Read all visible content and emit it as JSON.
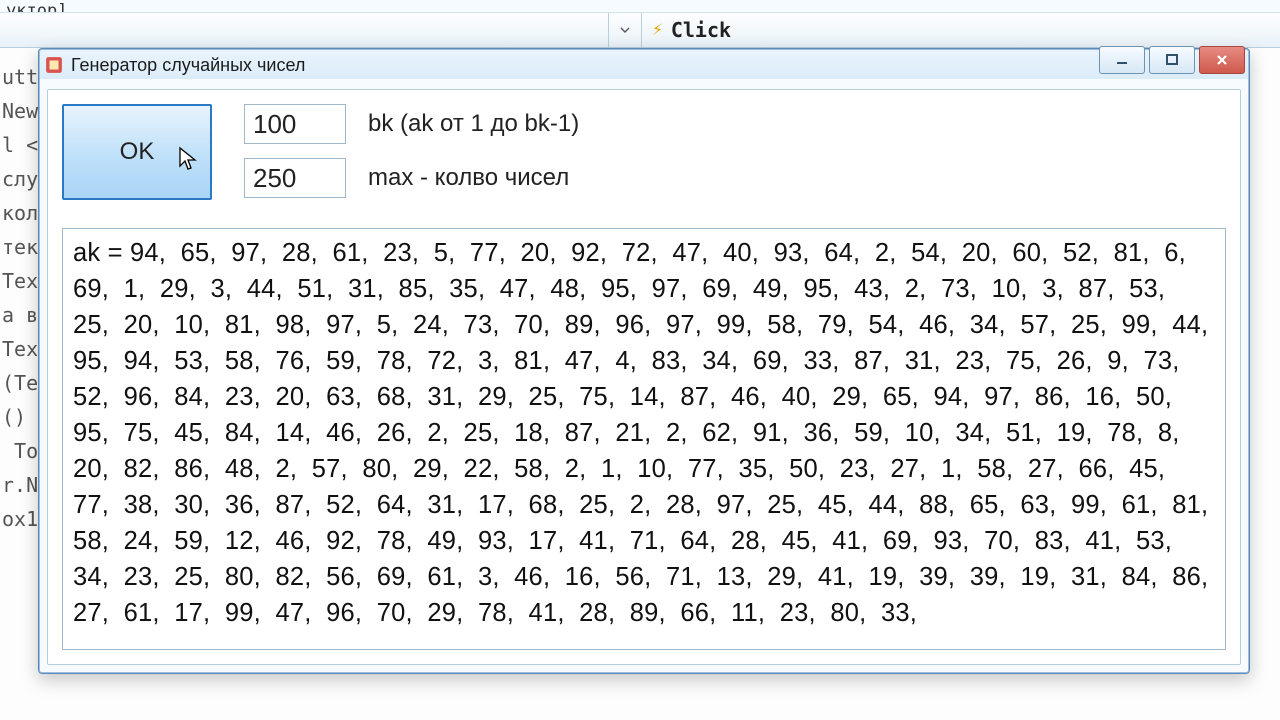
{
  "ide": {
    "title_fragment": "уктор]",
    "toolbar_item": "Click",
    "code_lines": [
      "utt",
      "New",
      "l <",
      "слу",
      "кол",
      "",
      "тек",
      "Tex",
      "а в",
      "Tex",
      "(Te",
      "",
      "()",
      " To",
      "",
      "r.N",
      "",
      "ox1"
    ]
  },
  "window": {
    "title": "Генератор случайных чисел",
    "ok_label": "OK",
    "bk_value": "100",
    "bk_label": "bk  (ak от 1 до bk-1)",
    "max_value": "250",
    "max_label": "max - колво чисел"
  },
  "output_prefix": "ak = ",
  "numbers": [
    94,
    65,
    97,
    28,
    61,
    23,
    5,
    77,
    20,
    92,
    72,
    47,
    40,
    93,
    64,
    2,
    54,
    20,
    60,
    52,
    81,
    6,
    69,
    1,
    29,
    3,
    44,
    51,
    31,
    85,
    35,
    47,
    48,
    95,
    97,
    69,
    49,
    95,
    43,
    2,
    73,
    10,
    3,
    87,
    53,
    25,
    20,
    10,
    81,
    98,
    97,
    5,
    24,
    73,
    70,
    89,
    96,
    97,
    99,
    58,
    79,
    54,
    46,
    34,
    57,
    25,
    99,
    44,
    95,
    94,
    53,
    58,
    76,
    59,
    78,
    72,
    3,
    81,
    47,
    4,
    83,
    34,
    69,
    33,
    87,
    31,
    23,
    75,
    26,
    9,
    73,
    52,
    96,
    84,
    23,
    20,
    63,
    68,
    31,
    29,
    25,
    75,
    14,
    87,
    46,
    40,
    29,
    65,
    94,
    97,
    86,
    16,
    50,
    95,
    75,
    45,
    84,
    14,
    46,
    26,
    2,
    25,
    18,
    87,
    21,
    2,
    62,
    91,
    36,
    59,
    10,
    34,
    51,
    19,
    78,
    8,
    20,
    82,
    86,
    48,
    2,
    57,
    80,
    29,
    22,
    58,
    2,
    1,
    10,
    77,
    35,
    50,
    23,
    27,
    1,
    58,
    27,
    66,
    45,
    77,
    38,
    30,
    36,
    87,
    52,
    64,
    31,
    17,
    68,
    25,
    2,
    28,
    97,
    25,
    45,
    44,
    88,
    65,
    63,
    99,
    61,
    81,
    58,
    24,
    59,
    12,
    46,
    92,
    78,
    49,
    93,
    17,
    41,
    71,
    64,
    28,
    45,
    41,
    69,
    93,
    70,
    83,
    41,
    53,
    34,
    23,
    25,
    80,
    82,
    56,
    69,
    61,
    3,
    46,
    16,
    56,
    71,
    13,
    29,
    41,
    19,
    39,
    39,
    19,
    31,
    84,
    86,
    27,
    61,
    17,
    99,
    47,
    96,
    70,
    29,
    78,
    41,
    28,
    89,
    66,
    11,
    23,
    80,
    33
  ]
}
